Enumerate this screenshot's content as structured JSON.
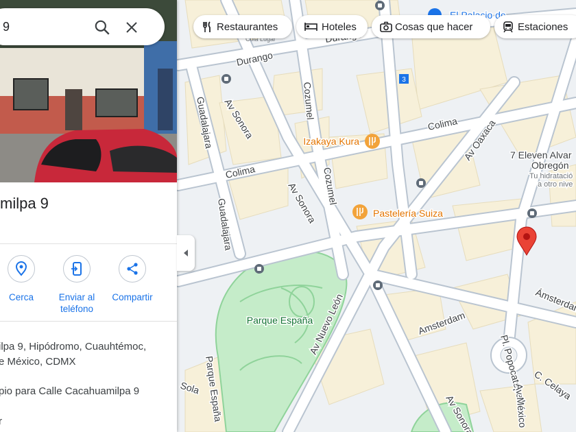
{
  "search": {
    "query": "9"
  },
  "place": {
    "title": "milpa 9"
  },
  "actions": [
    {
      "label": "Cerca"
    },
    {
      "label": "Enviar al teléfono"
    },
    {
      "label": "Compartir"
    }
  ],
  "details": {
    "address_line1": "ilpa 9, Hipódromo, Cuauhtémoc,",
    "address_line2": "e México, CDMX",
    "plus_code": "pio para Calle Cacahuamilpa 9",
    "more": "r"
  },
  "chips": [
    {
      "label": "Restaurantes",
      "icon": "fork-knife-icon"
    },
    {
      "label": "Hoteles",
      "icon": "bed-icon"
    },
    {
      "label": "Cosas que hacer",
      "icon": "camera-icon"
    },
    {
      "label": "Estaciones",
      "icon": "transit-icon"
    }
  ],
  "map": {
    "streets": [
      {
        "label": "Durango"
      },
      {
        "label": "Durango"
      },
      {
        "label": "Guadalajara"
      },
      {
        "label": "Av Sonora"
      },
      {
        "label": "Cozumel"
      },
      {
        "label": "Colima"
      },
      {
        "label": "Colima"
      },
      {
        "label": "Guadalajara"
      },
      {
        "label": "Cozumel"
      },
      {
        "label": "Av Sonora"
      },
      {
        "label": "Av Oaxaca"
      },
      {
        "label": "Av Nuevo León"
      },
      {
        "label": "Amsterdam"
      },
      {
        "label": "Ámsterdam"
      },
      {
        "label": "Pl. Popocatépetl"
      },
      {
        "label": "C. Celaya"
      },
      {
        "label": "Parque España"
      },
      {
        "label": "Sola"
      },
      {
        "label": "Av Sonora"
      },
      {
        "label": "Av México"
      }
    ],
    "park_label": "Parque España",
    "pois": [
      {
        "label": "Izakaya Kura",
        "icon": "restaurant-icon"
      },
      {
        "label": "Pastelería Suiza",
        "icon": "restaurant-icon"
      },
      {
        "label": "El Palacio de",
        "icon": "shopping-icon"
      }
    ],
    "route_badge": "3",
    "store": {
      "name": "7 Eleven Alvar",
      "name2": "Obregón",
      "desc": "Tu hidratació",
      "desc2": "a otro nive"
    },
    "cut_labels": [
      "Cola Lugar"
    ],
    "colors": {
      "road": "#ffffff",
      "road_edge": "#b9c4d0",
      "block": "#f7f0d9",
      "park": "#c5ecc9",
      "poi": "#f2a33a",
      "pin": "#ea4335",
      "accent": "#1a73e8"
    }
  }
}
